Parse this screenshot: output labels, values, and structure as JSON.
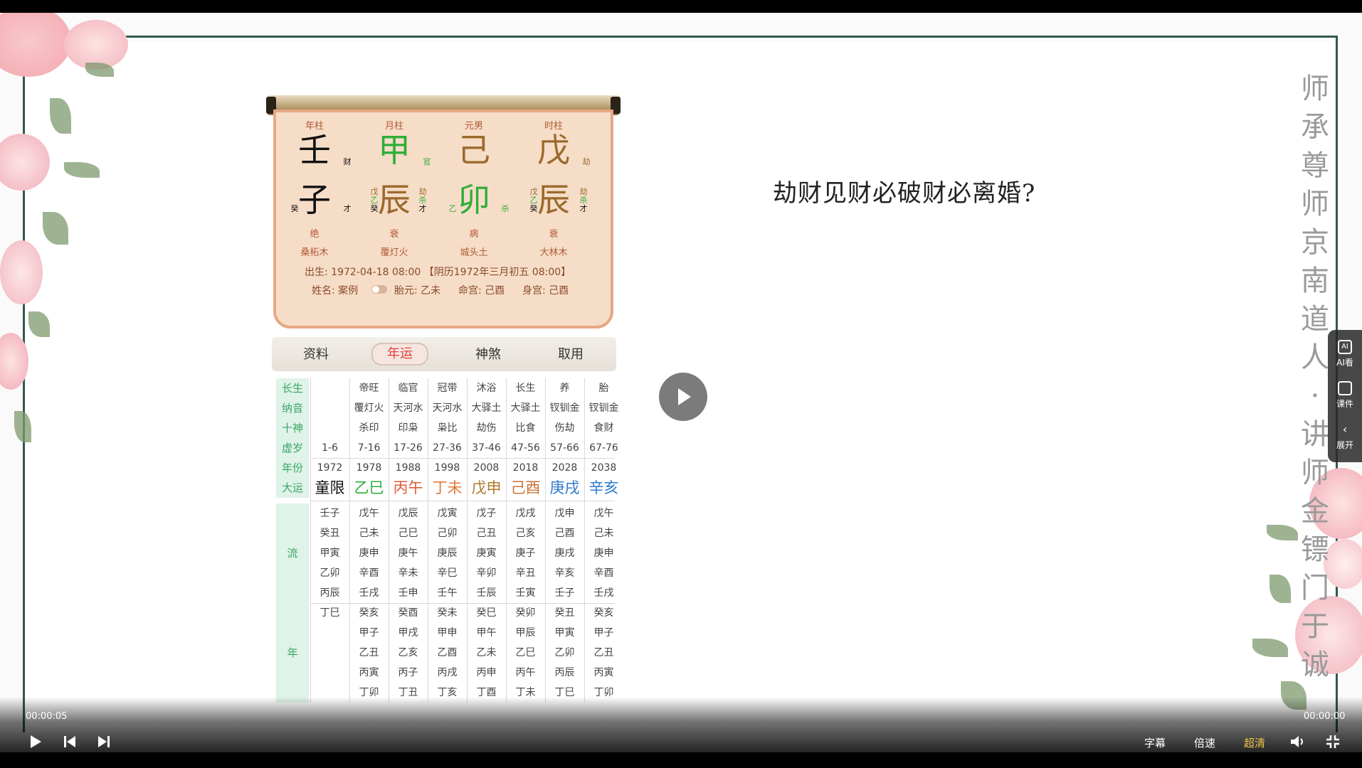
{
  "slide": {
    "question": "劫财见财必破财必离婚?",
    "side_title": "师承尊师京南道人 · 讲师金镖门于诚"
  },
  "chart": {
    "heads": [
      "年柱",
      "月柱",
      "元男",
      "时柱"
    ],
    "stems": [
      "壬",
      "甲",
      "己",
      "戊"
    ],
    "stem_gods": [
      "财",
      "官",
      "",
      "劫"
    ],
    "branches": [
      "子",
      "辰",
      "卯",
      "辰"
    ],
    "hidden_left": [
      [
        "癸"
      ],
      [
        "戊",
        "乙",
        "癸"
      ],
      [
        "乙"
      ],
      [
        "戊",
        "乙",
        "癸"
      ]
    ],
    "hidden_right": [
      [
        "才"
      ],
      [
        "劫",
        "杀",
        "才"
      ],
      [
        "杀"
      ],
      [
        "劫",
        "杀",
        "才"
      ]
    ],
    "life_stage": [
      "绝",
      "衰",
      "病",
      "衰"
    ],
    "nayin": [
      "桑柘木",
      "覆灯火",
      "城头土",
      "大林木"
    ],
    "birth": "出生: 1972-04-18 08:00 【阴历1972年三月初五 08:00】",
    "name_line": "姓名: 案例",
    "taiyuan": "胎元: 乙未",
    "minggong": "命宫: 己酉",
    "shengong": "身宫: 己酉",
    "colors": {
      "water": "#111111",
      "wood": "#2fae3a",
      "earth": "#9a6a2c"
    }
  },
  "tabs": [
    "资料",
    "年运",
    "神煞",
    "取用"
  ],
  "table": {
    "labels": {
      "changsheng": "长生",
      "nayin": "纳音",
      "shishen": "十神",
      "xusui": "虚岁",
      "nianfen": "年份",
      "dayun": "大运",
      "liu": "流",
      "nian": "年"
    },
    "changsheng": [
      "",
      "帝旺",
      "临官",
      "冠带",
      "沐浴",
      "长生",
      "养",
      "胎"
    ],
    "nayin": [
      "",
      "覆灯火",
      "天河水",
      "天河水",
      "大驿土",
      "大驿土",
      "钗钏金",
      "钗钏金"
    ],
    "shishen": [
      "",
      "杀印",
      "印枭",
      "枭比",
      "劫伤",
      "比食",
      "伤劫",
      "食财"
    ],
    "xusui": [
      "1-6",
      "7-16",
      "17-26",
      "27-36",
      "37-46",
      "47-56",
      "57-66",
      "67-76"
    ],
    "nianfen": [
      "1972",
      "1978",
      "1988",
      "1998",
      "2008",
      "2018",
      "2028",
      "2038"
    ],
    "dayun": [
      "童限",
      "乙巳",
      "丙午",
      "丁未",
      "戊申",
      "己酉",
      "庚戌",
      "辛亥"
    ],
    "liunian": [
      [
        "壬子",
        "戊午",
        "戊辰",
        "戊寅",
        "戊子",
        "戊戌",
        "戊申",
        "戊午"
      ],
      [
        "癸丑",
        "己未",
        "己巳",
        "己卯",
        "己丑",
        "己亥",
        "己酉",
        "己未"
      ],
      [
        "甲寅",
        "庚申",
        "庚午",
        "庚辰",
        "庚寅",
        "庚子",
        "庚戌",
        "庚申"
      ],
      [
        "乙卯",
        "辛酉",
        "辛未",
        "辛巳",
        "辛卯",
        "辛丑",
        "辛亥",
        "辛酉"
      ],
      [
        "丙辰",
        "壬戌",
        "壬申",
        "壬午",
        "壬辰",
        "壬寅",
        "壬子",
        "壬戌"
      ],
      [
        "丁巳",
        "癸亥",
        "癸酉",
        "癸未",
        "癸巳",
        "癸卯",
        "癸丑",
        "癸亥"
      ],
      [
        "",
        "甲子",
        "甲戌",
        "甲申",
        "甲午",
        "甲辰",
        "甲寅",
        "甲子"
      ],
      [
        "",
        "乙丑",
        "乙亥",
        "乙酉",
        "乙未",
        "乙巳",
        "乙卯",
        "乙丑"
      ],
      [
        "",
        "丙寅",
        "丙子",
        "丙戌",
        "丙申",
        "丙午",
        "丙辰",
        "丙寅"
      ],
      [
        "",
        "丁卯",
        "丁丑",
        "丁亥",
        "丁酉",
        "丁未",
        "丁巳",
        "丁卯"
      ]
    ]
  },
  "side_panel": {
    "ai": "AI看",
    "courseware": "课件",
    "expand": "展开"
  },
  "player": {
    "current_time": "00:00:05",
    "total_time": "00:00:00",
    "subtitles": "字幕",
    "speed": "倍速",
    "quality": "超清",
    "quality_color": "#f3c04a"
  }
}
